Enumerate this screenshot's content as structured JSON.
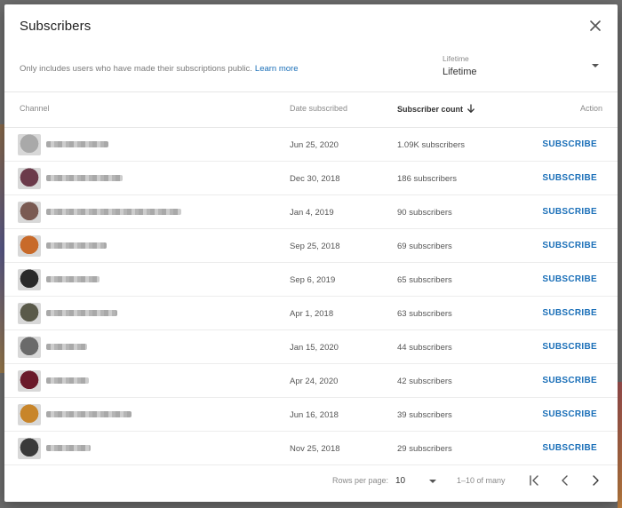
{
  "dialog": {
    "title": "Subscribers",
    "note": "Only includes users who have made their subscriptions public.",
    "learn_more": "Learn more",
    "period": {
      "caption": "Lifetime",
      "value": "Lifetime"
    }
  },
  "table": {
    "headers": {
      "channel": "Channel",
      "date": "Date subscribed",
      "count": "Subscriber count",
      "action": "Action"
    },
    "rows": [
      {
        "date": "Jun 25, 2020",
        "count": "1.09K subscribers",
        "action": "SUBSCRIBE",
        "avatar_color": "#a9a9a9"
      },
      {
        "date": "Dec 30, 2018",
        "count": "186 subscribers",
        "action": "SUBSCRIBE",
        "avatar_color": "#6b3a4a"
      },
      {
        "date": "Jan 4, 2019",
        "count": "90 subscribers",
        "action": "SUBSCRIBE",
        "avatar_color": "#7a5a52"
      },
      {
        "date": "Sep 25, 2018",
        "count": "69 subscribers",
        "action": "SUBSCRIBE",
        "avatar_color": "#c86a2a"
      },
      {
        "date": "Sep 6, 2019",
        "count": "65 subscribers",
        "action": "SUBSCRIBE",
        "avatar_color": "#2a2a2a"
      },
      {
        "date": "Apr 1, 2018",
        "count": "63 subscribers",
        "action": "SUBSCRIBE",
        "avatar_color": "#5a5a4a"
      },
      {
        "date": "Jan 15, 2020",
        "count": "44 subscribers",
        "action": "SUBSCRIBE",
        "avatar_color": "#6a6a6a"
      },
      {
        "date": "Apr 24, 2020",
        "count": "42 subscribers",
        "action": "SUBSCRIBE",
        "avatar_color": "#6a1a2a"
      },
      {
        "date": "Jun 16, 2018",
        "count": "39 subscribers",
        "action": "SUBSCRIBE",
        "avatar_color": "#c8852a"
      },
      {
        "date": "Nov 25, 2018",
        "count": "29 subscribers",
        "action": "SUBSCRIBE",
        "avatar_color": "#3a3a3a"
      }
    ]
  },
  "footer": {
    "rows_per_page_label": "Rows per page:",
    "rows_per_page_value": "10",
    "range": "1–10 of many"
  },
  "colors": {
    "accent": "#1a6fb8",
    "text": "#202020",
    "muted": "#8a8a8a"
  },
  "icons": {
    "close": "close-icon",
    "sort": "arrow-down-icon",
    "first": "first-page-icon",
    "prev": "chevron-left-icon",
    "next": "chevron-right-icon"
  }
}
